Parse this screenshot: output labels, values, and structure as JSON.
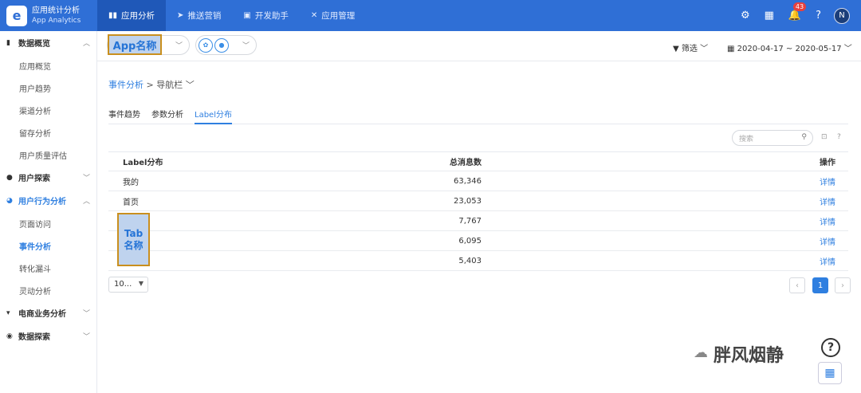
{
  "brand": {
    "title": "应用统计分析",
    "subtitle": "App Analytics",
    "logo_icon": "app-logo-icon"
  },
  "topnav": [
    {
      "label": "应用分析",
      "icon": "bar-chart-icon",
      "active": true
    },
    {
      "label": "推送营销",
      "icon": "send-icon"
    },
    {
      "label": "开发助手",
      "icon": "briefcase-icon"
    },
    {
      "label": "应用管理",
      "icon": "tools-icon"
    }
  ],
  "topright": {
    "notification_count": "43",
    "avatar": "N"
  },
  "sidebar": {
    "groups": [
      {
        "label": "数据概览",
        "icon": "bar-chart-icon",
        "items": [
          "应用概览",
          "用户趋势",
          "渠道分析",
          "留存分析",
          "用户质量评估"
        ]
      },
      {
        "label": "用户探索",
        "icon": "user-icon"
      },
      {
        "label": "用户行为分析",
        "icon": "pie-icon",
        "items": [
          "页面访问",
          "事件分析",
          "转化漏斗",
          "灵动分析"
        ]
      },
      {
        "label": "电商业务分析",
        "icon": "cart-icon"
      },
      {
        "label": "数据探索",
        "icon": "compass-icon"
      }
    ]
  },
  "header": {
    "app_name": "App名称",
    "filter_label": "筛选",
    "date_range": "2020-04-17 ~ 2020-05-17"
  },
  "breadcrumb": {
    "parent": "事件分析",
    "sep": ">",
    "current": "导航栏"
  },
  "tabs": [
    "事件趋势",
    "参数分析",
    "Label分布"
  ],
  "search": {
    "placeholder": "搜索"
  },
  "table": {
    "columns": [
      "Label分布",
      "总消息数",
      "操作"
    ],
    "rows": [
      {
        "label": "我的",
        "count": "63,346",
        "action": "详情"
      },
      {
        "label": "首页",
        "count": "23,053",
        "action": "详情"
      },
      {
        "label": "",
        "count": "7,767",
        "action": "详情"
      },
      {
        "label": "",
        "count": "6,095",
        "action": "详情"
      },
      {
        "label": "",
        "count": "5,403",
        "action": "详情"
      }
    ]
  },
  "annotation": {
    "tab_name": "Tab 名称"
  },
  "pagination": {
    "page_size": "10...",
    "current_page": "1"
  },
  "watermark": "胖风烟静"
}
